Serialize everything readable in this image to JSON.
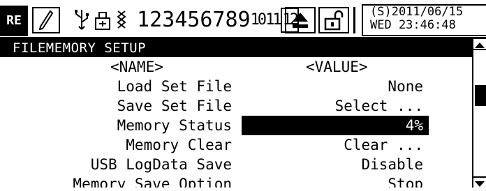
{
  "status": {
    "mode": "RE",
    "icons": [
      "pen-icon",
      "usb-icon",
      "printer-icon",
      "battery-icon"
    ],
    "channels": [
      "1",
      "2",
      "3",
      "4",
      "5",
      "6",
      "7",
      "8",
      "9",
      "10",
      "11",
      "12"
    ],
    "buttons": [
      "eject-icon",
      "unlock-icon"
    ],
    "clock_line1": "(S)2011/06/15",
    "clock_line2": "WED 23:46:48"
  },
  "title": "FILEMEMORY SETUP",
  "columns": {
    "name": "<NAME>",
    "value": "<VALUE>"
  },
  "rows": [
    {
      "name": "Load Set File",
      "value": "None"
    },
    {
      "name": "Save Set File",
      "value": "Select ..."
    },
    {
      "name": "Memory Status",
      "value": "4%",
      "selected": true
    },
    {
      "name": "Memory Clear",
      "value": "Clear ..."
    },
    {
      "name": "USB LogData Save",
      "value": "Disable"
    },
    {
      "name": "Memory Save Option",
      "value": "Stop"
    }
  ],
  "colors": {
    "background": "#ffffff",
    "foreground": "#000000",
    "highlight": "#000000"
  }
}
